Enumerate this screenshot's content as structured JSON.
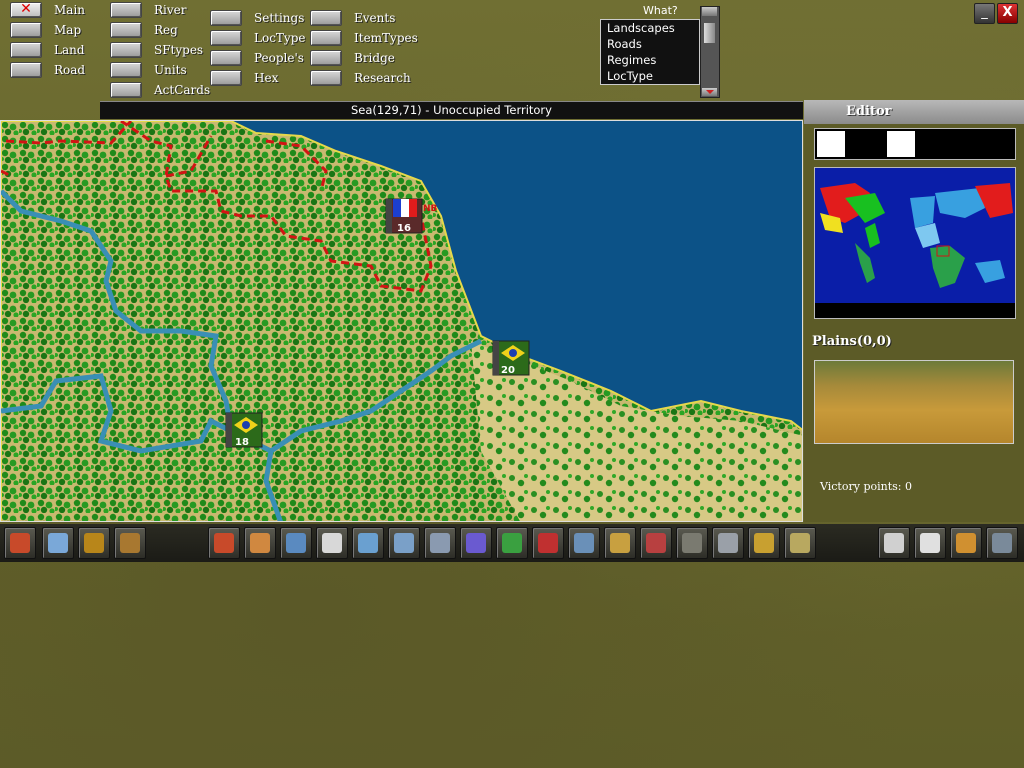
{
  "top_menu": {
    "col1": [
      {
        "label": "Main",
        "active": true
      },
      {
        "label": "Map"
      },
      {
        "label": "Land"
      },
      {
        "label": "Road"
      }
    ],
    "col2": [
      {
        "label": "River"
      },
      {
        "label": "Reg"
      },
      {
        "label": "SFtypes"
      },
      {
        "label": "Units"
      },
      {
        "label": "ActCards"
      }
    ],
    "col3": [
      {
        "label": "Settings"
      },
      {
        "label": "LocType"
      },
      {
        "label": "People's"
      },
      {
        "label": "Hex"
      }
    ],
    "col4": [
      {
        "label": "Events"
      },
      {
        "label": "ItemTypes"
      },
      {
        "label": "Bridge"
      },
      {
        "label": "Research"
      }
    ]
  },
  "what": {
    "label": "What?",
    "options": [
      "Landscapes",
      "Roads",
      "Regimes",
      "LocType"
    ]
  },
  "window": {
    "minimize": "_",
    "close": "X"
  },
  "infobar": {
    "text": "Sea(129,71) - Unoccupied Territory"
  },
  "units": [
    {
      "strength": "16",
      "flag": "france"
    },
    {
      "strength": "20",
      "flag": "brazil"
    },
    {
      "strength": "18",
      "flag": "brazil"
    }
  ],
  "editor": {
    "title": "Editor",
    "terrain_title": "Plains(0,0)",
    "victory": "Victory points: 0"
  },
  "toolbar": {
    "left": [
      "undo-icon",
      "computer-icon",
      "factory-hq-icon",
      "factory-icon"
    ],
    "middle": [
      "rocket-icon",
      "artillery-icon",
      "pliers-icon",
      "hq-flag-icon",
      "globe-icon",
      "aircraft-icon",
      "gun-icon",
      "fortress-icon",
      "add-icon",
      "remove-icon",
      "plane-icon",
      "tank-icon",
      "factory-red-icon",
      "road-icon",
      "chart-icon",
      "check-icon",
      "hexagon-icon"
    ],
    "right": [
      "flag-icon",
      "book-icon",
      "map-tools-icon",
      "rifles-icon"
    ]
  },
  "colors": {
    "sea": "#0c5287",
    "land": "#d2c27a",
    "forest": "#2a7a1e",
    "river": "#3a8fb5",
    "border": "#d21414"
  }
}
